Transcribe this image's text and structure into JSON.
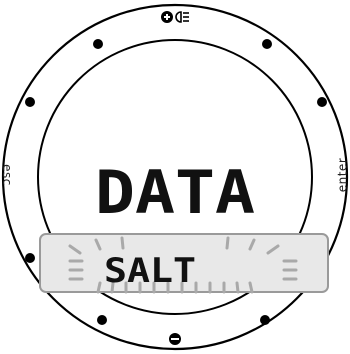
{
  "watch": {
    "display": {
      "main_text": "DATA",
      "sub_text": "SALT"
    },
    "buttons": {
      "esc_label": "esc",
      "enter_label": "enter",
      "up_icon": "plus-light-icon",
      "down_icon": "minus-icon"
    }
  }
}
